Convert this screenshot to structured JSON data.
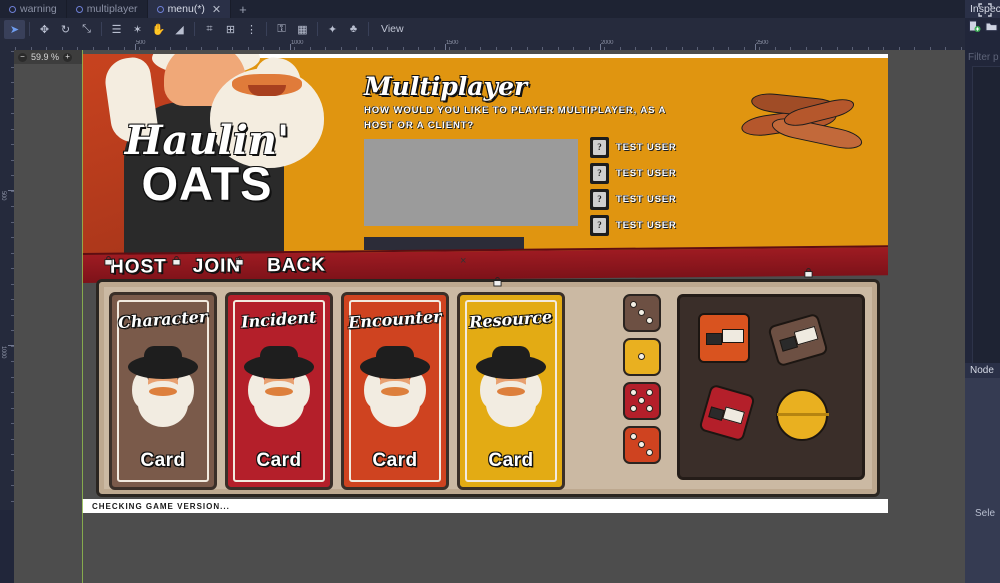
{
  "editor": {
    "tabs": [
      {
        "label": "warning",
        "active": false,
        "closable": false
      },
      {
        "label": "multiplayer",
        "active": false,
        "closable": false
      },
      {
        "label": "menu(*)",
        "active": true,
        "closable": true
      }
    ],
    "tab_close_glyph": "✕",
    "tab_add_glyph": "+",
    "toolbar": {
      "tools": [
        {
          "name": "select-tool",
          "glyph": "➤",
          "active": true
        },
        {
          "name": "move-tool",
          "glyph": "✥",
          "active": false
        },
        {
          "name": "rotate-tool",
          "glyph": "↻",
          "active": false
        },
        {
          "name": "scale-tool",
          "glyph": "⤡",
          "active": false
        },
        {
          "name": "list-tool",
          "glyph": "☰",
          "active": false
        },
        {
          "name": "ruler-tool",
          "glyph": "✶",
          "active": false
        },
        {
          "name": "pan-tool",
          "glyph": "✋",
          "active": false
        },
        {
          "name": "ruler-measure-tool",
          "glyph": "◢",
          "active": false
        },
        {
          "name": "smart-snap-tool",
          "glyph": "⌗",
          "active": false
        },
        {
          "name": "grid-snap-tool",
          "glyph": "⊞",
          "active": false
        },
        {
          "name": "snap-options-tool",
          "glyph": "⋮",
          "active": false
        },
        {
          "name": "lock-tool",
          "glyph": "⚿",
          "active": false
        },
        {
          "name": "group-tool",
          "glyph": "▦",
          "active": false
        },
        {
          "name": "bone-tool",
          "glyph": "✦",
          "active": false
        },
        {
          "name": "skeleton-tool",
          "glyph": "♣",
          "active": false
        }
      ],
      "view_menu_label": "View"
    },
    "zoom": {
      "value": "59.9 %",
      "minus": "−",
      "plus": "+"
    },
    "expand_icon": "expand-icon",
    "ruler_h_labels": [
      "500",
      "1000",
      "1500",
      "2000",
      "2500"
    ],
    "ruler_v_labels": [
      "500",
      "1000"
    ],
    "inspector": {
      "tab_label": "Inspector",
      "filter_placeholder": "Filter p",
      "icons": [
        "new-resource-icon",
        "open-resource-icon"
      ]
    },
    "node_panel": {
      "tab_label": "Node",
      "empty_text": "Sele"
    }
  },
  "game": {
    "logo": {
      "line1": "Haulin'",
      "line2": "OATS"
    },
    "dialog": {
      "title": "Multiplayer",
      "description": "How would you like to player multiplayer, as a host or a client?",
      "chat_log": "",
      "chat_input_value": "",
      "users": [
        {
          "name": "Test User",
          "avatar_glyph": "?"
        },
        {
          "name": "Test User",
          "avatar_glyph": "?"
        },
        {
          "name": "Test User",
          "avatar_glyph": "?"
        },
        {
          "name": "Test User",
          "avatar_glyph": "?"
        }
      ]
    },
    "actions": [
      {
        "label": "Host",
        "name": "host-button"
      },
      {
        "label": "Join",
        "name": "join-button"
      },
      {
        "label": "Back",
        "name": "back-button"
      }
    ],
    "cards": [
      {
        "title": "Character",
        "footer": "Card",
        "color": "#7a5a4a"
      },
      {
        "title": "Incident",
        "footer": "Card",
        "color": "#b41f2a"
      },
      {
        "title": "Encounter",
        "footer": "Card",
        "color": "#cf4320"
      },
      {
        "title": "Resource",
        "footer": "Card",
        "color": "#e3ab14"
      }
    ],
    "dice": [
      {
        "color": "#6d5043",
        "value": 3
      },
      {
        "color": "#e9b020",
        "value": 1
      },
      {
        "color": "#b41f2a",
        "value": 5
      },
      {
        "color": "#cf4320",
        "value": 3
      }
    ],
    "tokens": [
      {
        "name": "truck-token-orange",
        "color": "#d9531f"
      },
      {
        "name": "truck-token-brown",
        "color": "#6d5043"
      },
      {
        "name": "truck-token-red",
        "color": "#b41f2a"
      },
      {
        "name": "truck-token-yellow",
        "color": "#e9b020"
      }
    ],
    "status": "Checking game version...",
    "colors": {
      "header_orange": "#e09510",
      "header_red": "#c8431f",
      "action_bar_red": "#9e1b22",
      "table_tan": "#cbb9a3"
    }
  }
}
